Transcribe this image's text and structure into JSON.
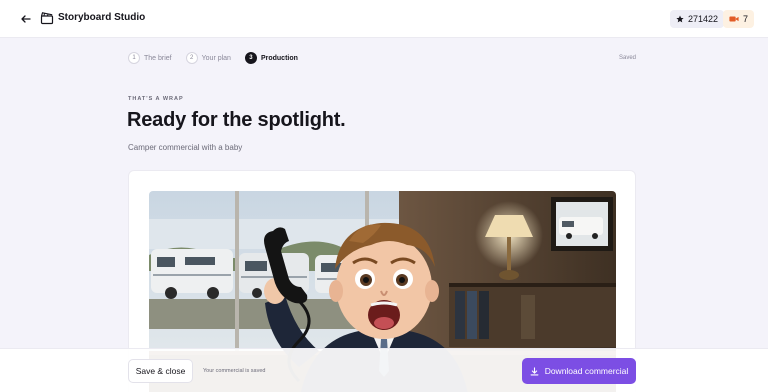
{
  "header": {
    "title": "Storyboard Studio",
    "stars_count": "271422",
    "credits_count": "7"
  },
  "steps": [
    {
      "number": "1",
      "label": "The brief"
    },
    {
      "number": "2",
      "label": "Your plan"
    },
    {
      "number": "3",
      "label": "Production"
    }
  ],
  "status": {
    "saved": "Saved"
  },
  "hero": {
    "kicker": "THAT'S A WRAP",
    "title": "Ready for the spotlight.",
    "subtitle": "Camper commercial with a baby"
  },
  "footer": {
    "save_close_label": "Save & close",
    "save_status": "Your commercial is saved",
    "download_label": "Download commercial"
  },
  "colors": {
    "accent": "#7c4ee4",
    "page_bg": "#f4f3fa",
    "text": "#16151c"
  },
  "icons": {
    "back": "arrow-left-icon",
    "app": "clapperboard-icon",
    "stars": "star-icon",
    "credits": "video-camera-icon",
    "download": "download-icon"
  }
}
